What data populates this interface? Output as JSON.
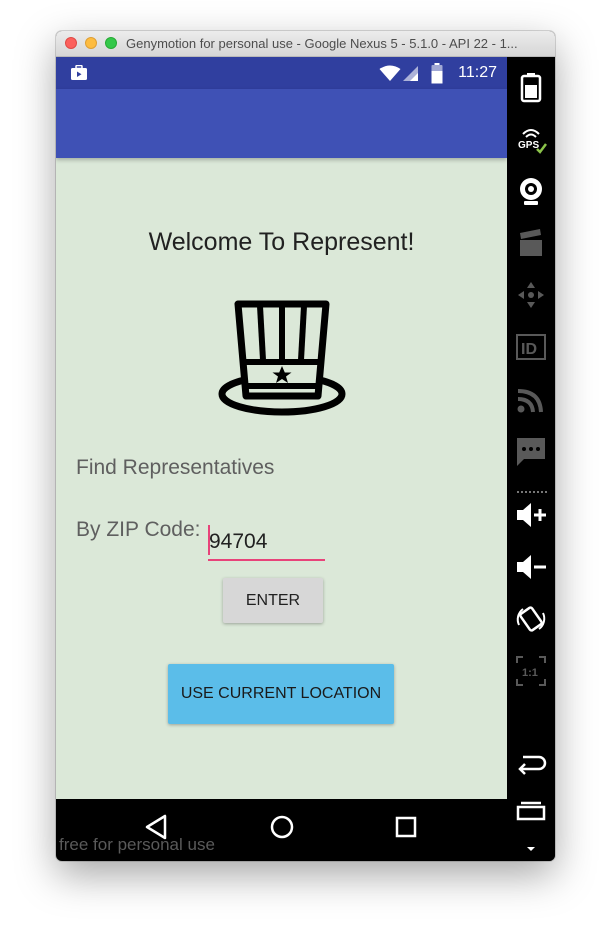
{
  "window": {
    "title": "Genymotion for personal use - Google Nexus 5 - 5.1.0 - API 22 - 1..."
  },
  "statusbar": {
    "time": "11:27"
  },
  "main": {
    "welcome": "Welcome To Represent!",
    "find_label": "Find Representatives",
    "zip_label": "By ZIP Code:",
    "zip_value": "94704",
    "enter_label": "ENTER",
    "location_label": "USE CURRENT LOCATION"
  },
  "watermark": "free for personal use",
  "sidebar": {
    "gps_label": "GPS",
    "id_label": "ID",
    "ratio_label": "1:1"
  },
  "colors": {
    "status_bar": "#303f9f",
    "app_bar": "#3f51b5",
    "background": "#dbe8d8",
    "accent": "#e8437a",
    "location_button": "#5bbde9",
    "enter_button": "#d7d7d7"
  },
  "icons": {
    "hat": "uncle-sam-hat-icon",
    "back": "back-triangle-icon",
    "home": "home-circle-icon",
    "recents": "recents-square-icon"
  }
}
